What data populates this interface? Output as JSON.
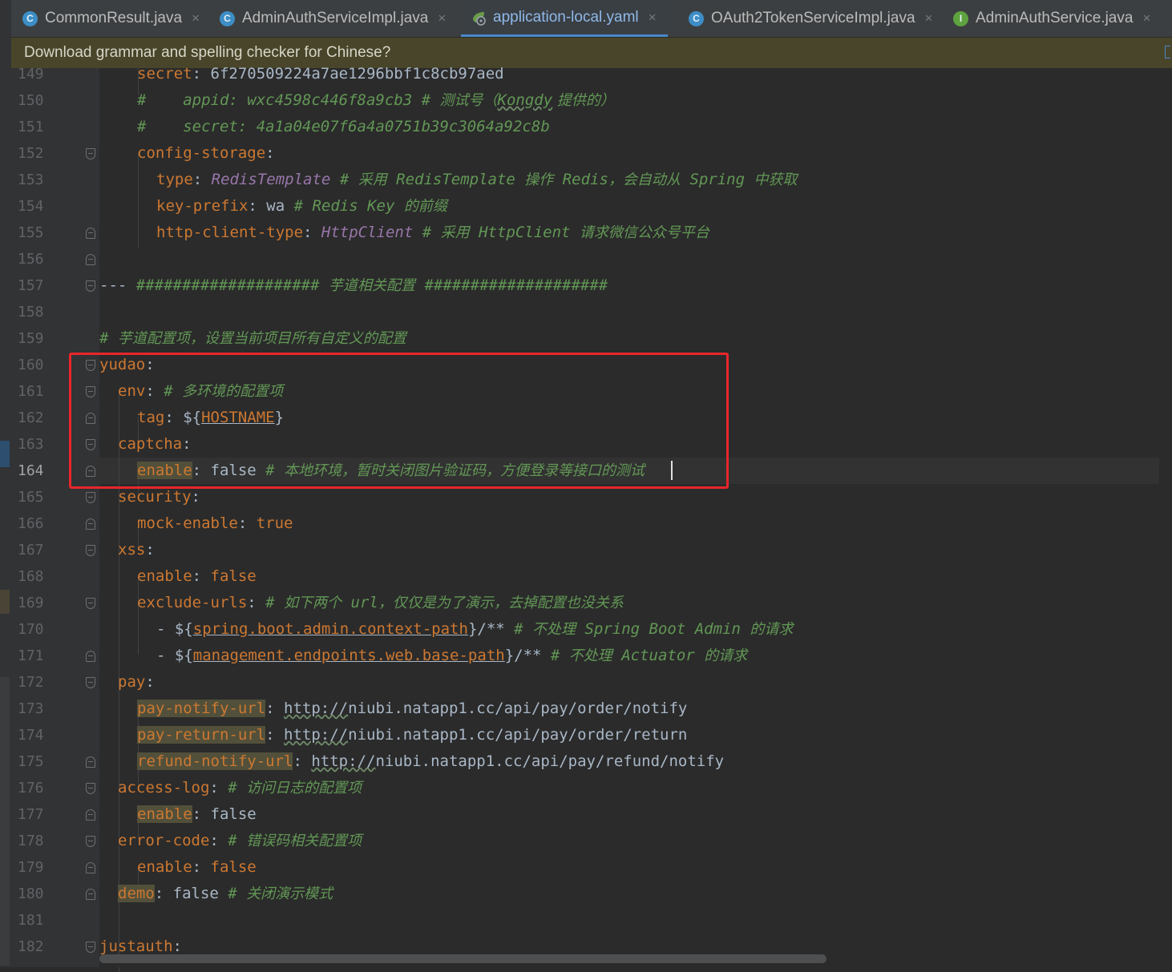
{
  "tabs": [
    {
      "icon": "C",
      "label": "CommonResult.java",
      "icon_color": "#3d8ec7"
    },
    {
      "icon": "C",
      "label": "AdminAuthServiceImpl.java",
      "icon_color": "#3d8ec7"
    },
    {
      "icon": "",
      "label": "application-local.yaml",
      "icon_color": "#6a9c4b",
      "active": true
    },
    {
      "icon": "C",
      "label": "OAuth2TokenServiceImpl.java",
      "icon_color": "#3d8ec7"
    },
    {
      "icon": "I",
      "label": "AdminAuthService.java",
      "icon_color": "#5ea33f"
    }
  ],
  "tab_close_glyph": "×",
  "notification": {
    "text": "Download grammar and spelling checker for Chinese?"
  },
  "editor": {
    "current_line": 164,
    "line_numbers": [
      "149",
      "150",
      "151",
      "152",
      "153",
      "154",
      "155",
      "156",
      "157",
      "158",
      "159",
      "160",
      "161",
      "162",
      "163",
      "164",
      "165",
      "166",
      "167",
      "168",
      "169",
      "170",
      "171",
      "172",
      "173",
      "174",
      "175",
      "176",
      "177",
      "178",
      "179",
      "180",
      "181",
      "182"
    ],
    "code": {
      "l149_key": "secret",
      "l149_val": "6f270509224a7ae1296bbf1c8cb97aed",
      "l150": "#    appid: wxc4598c446f8a9cb3 # ",
      "l150_cn1": "测试号（",
      "l150_kongdy": "Kongdy",
      "l150_cn2": " 提供的）",
      "l151": "#    secret: 4a1a04e07f6a4a0751b39c3064a92c8b",
      "l152_key": "config-storage",
      "l153_key": "type",
      "l153_val": "RedisTemplate",
      "l153_c1": " # ",
      "l153_cn1": "采用",
      "l153_c2": " RedisTemplate ",
      "l153_cn2": "操作",
      "l153_c3": " Redis",
      "l153_cn3": "，会自动从",
      "l153_c4": " Spring ",
      "l153_cn4": "中获取",
      "l154_key": "key-prefix",
      "l154_val": "wa",
      "l154_c1": " # Redis Key ",
      "l154_cn1": "的前缀",
      "l155_key": "http-client-type",
      "l155_val": "HttpClient",
      "l155_c1": " # ",
      "l155_cn1": "采用",
      "l155_c2": " HttpClient ",
      "l155_cn2": "请求微信公众号平台",
      "l157_dash": "---",
      "l157_c1": " #################### ",
      "l157_cn1": "芋道相关配置",
      "l157_c2": " ####################",
      "l159_c1": "# ",
      "l159_cn1": "芋道配置项，设置当前项目所有自定义的配置",
      "l160_key": "yudao",
      "l161_key": "env",
      "l161_c1": " # ",
      "l161_cn1": "多环境的配置项",
      "l162_key": "tag",
      "l162_pre": "${",
      "l162_var": "HOSTNAME",
      "l162_post": "}",
      "l163_key": "captcha",
      "l164_key": "enable",
      "l164_val": "false",
      "l164_c1": " # ",
      "l164_cn1": "本地环境，暂时关闭图片验证码，方便登录等接口的测试",
      "l165_key": "security",
      "l166_key": "mock-enable",
      "l166_val": "true",
      "l167_key": "xss",
      "l168_key": "enable",
      "l168_val": "false",
      "l169_key": "exclude-urls",
      "l169_c1": " # ",
      "l169_cn1": "如下两个",
      "l169_c2": " url",
      "l169_cn2": "，仅仅是为了演示，去掉配置也没关系",
      "l170_pre": "- ${",
      "l170_var": "spring.boot.admin.context-path",
      "l170_post": "}/**",
      "l170_c1": " # ",
      "l170_cn1": "不处理",
      "l170_c2": " Spring Boot Admin ",
      "l170_cn2": "的请求",
      "l171_pre": "- ${",
      "l171_var": "management.endpoints.web.base-path",
      "l171_post": "}/**",
      "l171_c1": " # ",
      "l171_cn1": "不处理",
      "l171_c2": " Actuator ",
      "l171_cn2": "的请求",
      "l172_key": "pay",
      "l173_key": "pay-notify-url",
      "l173_http": "http://",
      "l173_rest": "niubi.natapp1.cc/api/pay/order/notify",
      "l174_key": "pay-return-url",
      "l174_http": "http://",
      "l174_rest": "niubi.natapp1.cc/api/pay/order/return",
      "l175_key": "refund-notify-url",
      "l175_http": "http://",
      "l175_rest": "niubi.natapp1.cc/api/pay/refund/notify",
      "l176_key": "access-log",
      "l176_c1": " # ",
      "l176_cn1": "访问日志的配置项",
      "l177_key": "enable",
      "l177_val": "false",
      "l178_key": "error-code",
      "l178_c1": " # ",
      "l178_cn1": "错误码相关配置项",
      "l179_key": "enable",
      "l179_val": "false",
      "l180_key": "demo",
      "l180_val": "false",
      "l180_c1": " # ",
      "l180_cn1": "关闭演示模式",
      "l182_key": "justauth"
    }
  },
  "colors": {
    "highlight_box": "#e8262b",
    "keyword": "#cc7832",
    "comment": "#629755",
    "value": "#a9b7c6",
    "accent": "#4a88c7"
  },
  "icons": {
    "tab_java_class": "class-c-icon",
    "tab_yaml": "yaml-file-icon",
    "tab_interface": "interface-i-icon",
    "fold": "fold-marker-icon"
  }
}
